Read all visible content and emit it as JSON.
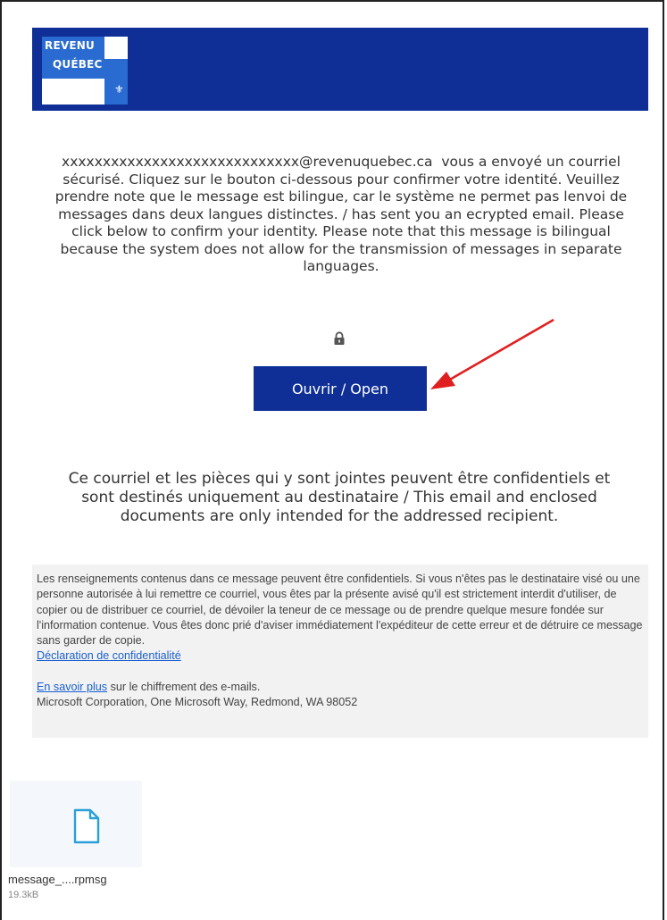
{
  "logo": {
    "line1": "REVENU",
    "line2": "QUÉBEC",
    "mark": "fleur-de-lis-icon"
  },
  "intro": {
    "sender": "xxxxxxxxxxxxxxxxxxxxxxxxxxxxx@revenuquebec.ca",
    "message": "vous a envoyé un courriel sécurisé. Cliquez sur le bouton ci-dessous pour confirmer votre identité. Veuillez prendre note que le message est bilingue, car le système ne permet pas lenvoi de messages dans deux langues distinctes. / has sent you an ecrypted email. Please click below to confirm your identity. Please note that this message is bilingual because the system does not allow for the transmission of messages in separate languages."
  },
  "lock_icon": "lock-icon",
  "open_button": {
    "label": "Ouvrir / Open"
  },
  "confidential_note": "Ce courriel et les pièces qui y sont jointes peuvent être confidentiels et sont destinés uniquement au destinataire / This email and enclosed documents are only intended for the addressed recipient.",
  "disclaimer": {
    "text": "Les renseignements contenus dans ce message peuvent être confidentiels. Si vous n'êtes pas le destinataire visé ou une personne autorisée à lui remettre ce courriel, vous êtes par la présente avisé qu'il est strictement interdit d'utiliser, de copier ou de distribuer ce courriel, de dévoiler la teneur de ce message ou de prendre quelque mesure fondée sur l'information contenue. Vous êtes donc prié d'aviser immédiatement l'expéditeur de cette erreur et de détruire ce message sans garder de copie.",
    "privacy_link": "Déclaration de confidentialité",
    "learn_more_link": "En savoir plus",
    "learn_more_suffix": "sur le chiffrement des e-mails.",
    "footer": "Microsoft Corporation, One Microsoft Way, Redmond, WA 98052"
  },
  "attachment": {
    "name": "message_....rpmsg",
    "size": "19.3kB",
    "icon": "file-icon"
  },
  "colors": {
    "brand_navy": "#0f2f96",
    "logo_blue": "#2a6bd1",
    "link_blue": "#1a5fcf",
    "annotation_arrow": "#e02020"
  }
}
